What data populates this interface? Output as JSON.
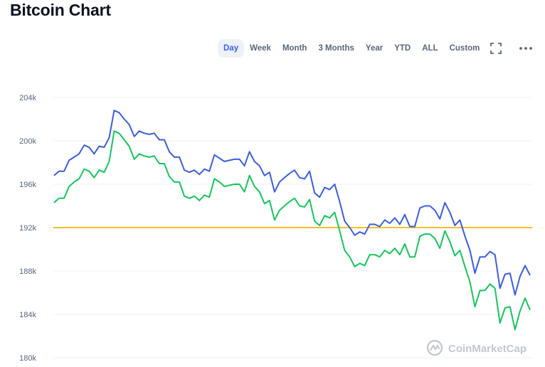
{
  "title": "Bitcoin Chart",
  "toolbar": {
    "ranges": [
      "Day",
      "Week",
      "Month",
      "3 Months",
      "Year",
      "YTD",
      "ALL",
      "Custom"
    ],
    "active_range": "Day",
    "fullscreen_icon": "fullscreen-icon",
    "more_icon": "more-horizontal-icon"
  },
  "watermark": "CoinMarketCap",
  "colors": {
    "blue_series": "#3b5ee0",
    "green_series": "#16c75a",
    "reference_line": "#f0b90b",
    "grid": "#eff2f5",
    "active_tab": "#3861fb"
  },
  "chart_data": {
    "type": "line",
    "ylim": [
      180000,
      204000
    ],
    "yticks": [
      "180k",
      "184k",
      "188k",
      "192k",
      "196k",
      "200k",
      "204k"
    ],
    "ytick_values": [
      180000,
      184000,
      188000,
      192000,
      196000,
      200000,
      204000
    ],
    "grid": true,
    "reference_line": 192000,
    "series": [
      {
        "color": "#3b5ee0",
        "values": [
          196800,
          197200,
          197200,
          198200,
          198500,
          198800,
          199600,
          199400,
          198800,
          199500,
          199400,
          200300,
          202800,
          202600,
          202000,
          201500,
          200400,
          200900,
          200700,
          200600,
          200700,
          200100,
          200100,
          199000,
          198500,
          198500,
          197300,
          197100,
          197300,
          196900,
          197400,
          197200,
          198700,
          198400,
          198100,
          198200,
          198300,
          198300,
          197700,
          199000,
          198100,
          197700,
          196800,
          197100,
          195300,
          196200,
          196600,
          197000,
          197300,
          196600,
          196500,
          197200,
          195200,
          194800,
          195700,
          195500,
          196000,
          194400,
          192600,
          192000,
          191300,
          191600,
          191400,
          192300,
          192300,
          192100,
          192700,
          192400,
          192900,
          192300,
          193200,
          192100,
          192100,
          193800,
          194000,
          194000,
          193600,
          192800,
          194300,
          193400,
          192200,
          192700,
          191200,
          189900,
          187800,
          189300,
          189300,
          189800,
          189500,
          186400,
          187700,
          187800,
          185800,
          187500,
          188500,
          187600
        ]
      },
      {
        "color": "#16c75a",
        "values": [
          194300,
          194700,
          194700,
          195800,
          196200,
          196500,
          197400,
          197200,
          196600,
          197300,
          197100,
          198100,
          200900,
          200700,
          200100,
          199500,
          198300,
          198800,
          198600,
          198500,
          198600,
          197900,
          197900,
          196700,
          196200,
          196200,
          194900,
          194700,
          194900,
          194500,
          195000,
          194800,
          196500,
          196200,
          195800,
          195900,
          196000,
          196000,
          195300,
          196800,
          195800,
          195300,
          194200,
          194500,
          192700,
          193600,
          194000,
          194400,
          194700,
          194000,
          193900,
          194600,
          192600,
          192200,
          193100,
          192900,
          193400,
          191700,
          189900,
          189300,
          188400,
          188700,
          188500,
          189500,
          189500,
          189300,
          189900,
          189600,
          190100,
          189500,
          190500,
          189300,
          189300,
          191200,
          191400,
          191400,
          191000,
          190100,
          191700,
          190700,
          189400,
          189900,
          188400,
          187000,
          184700,
          186200,
          186200,
          186800,
          186400,
          183200,
          184600,
          184700,
          182600,
          184300,
          185500,
          184400
        ]
      }
    ]
  }
}
